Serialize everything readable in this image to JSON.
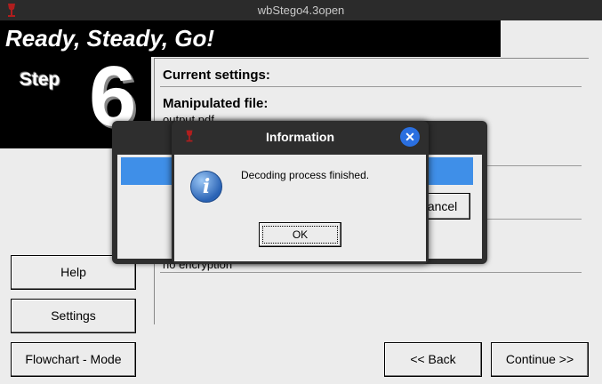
{
  "window": {
    "title": "wbStego4.3open"
  },
  "banner": {
    "text": "Ready, Steady, Go!"
  },
  "step": {
    "label": "Step",
    "number": "6"
  },
  "settings": {
    "current_settings_label": "Current settings:",
    "manipulated_file_label": "Manipulated file:",
    "manipulated_file_value": "output.pdf",
    "encryption_value": "no encryption"
  },
  "buttons": {
    "help": "Help",
    "settings": "Settings",
    "flowchart": "Flowchart - Mode",
    "back": "<< Back",
    "continue": "Continue >>"
  },
  "progress_dialog": {
    "cancel_label": "Cancel",
    "bar_color": "#3f8fe8"
  },
  "info_dialog": {
    "title": "Information",
    "message": "Decoding process finished.",
    "ok_label": "OK",
    "icon": "info-icon"
  }
}
